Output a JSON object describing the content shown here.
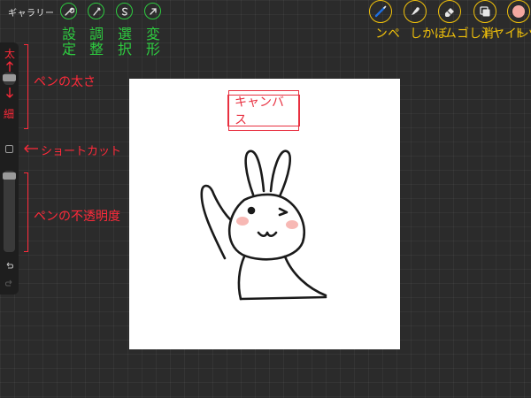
{
  "topbar": {
    "gallery_label": "ギャラリー",
    "left_tools": [
      {
        "icon": "wrench-icon",
        "note": "設定"
      },
      {
        "icon": "wand-icon",
        "note": "調整"
      },
      {
        "icon": "selection-icon",
        "note": "選択"
      },
      {
        "icon": "cursor-arrow-icon",
        "note": "変形"
      }
    ],
    "right_tools": [
      {
        "icon": "brush-icon",
        "note": "ペン"
      },
      {
        "icon": "smudge-icon",
        "note": "ぼかし"
      },
      {
        "icon": "eraser-icon",
        "note": "消しゴム"
      },
      {
        "icon": "layers-icon",
        "note": "レイヤー"
      },
      {
        "icon": "color-swatch-icon",
        "note": "カラーパレット"
      }
    ]
  },
  "sidebar": {
    "size_top": "太",
    "size_bottom": "細",
    "size_note": "ペンの太さ",
    "shortcut_note": "ショートカット",
    "opacity_note": "ペンの不透明度",
    "brush_size_level": 0.7,
    "opacity_level": 0.98
  },
  "canvas": {
    "label": "キャンバス"
  },
  "colors": {
    "tool_green": "#2ecc40",
    "tool_yellow": "#f2c20a",
    "note_red": "#ff2a3a",
    "swatch": "#f4a8a0"
  }
}
